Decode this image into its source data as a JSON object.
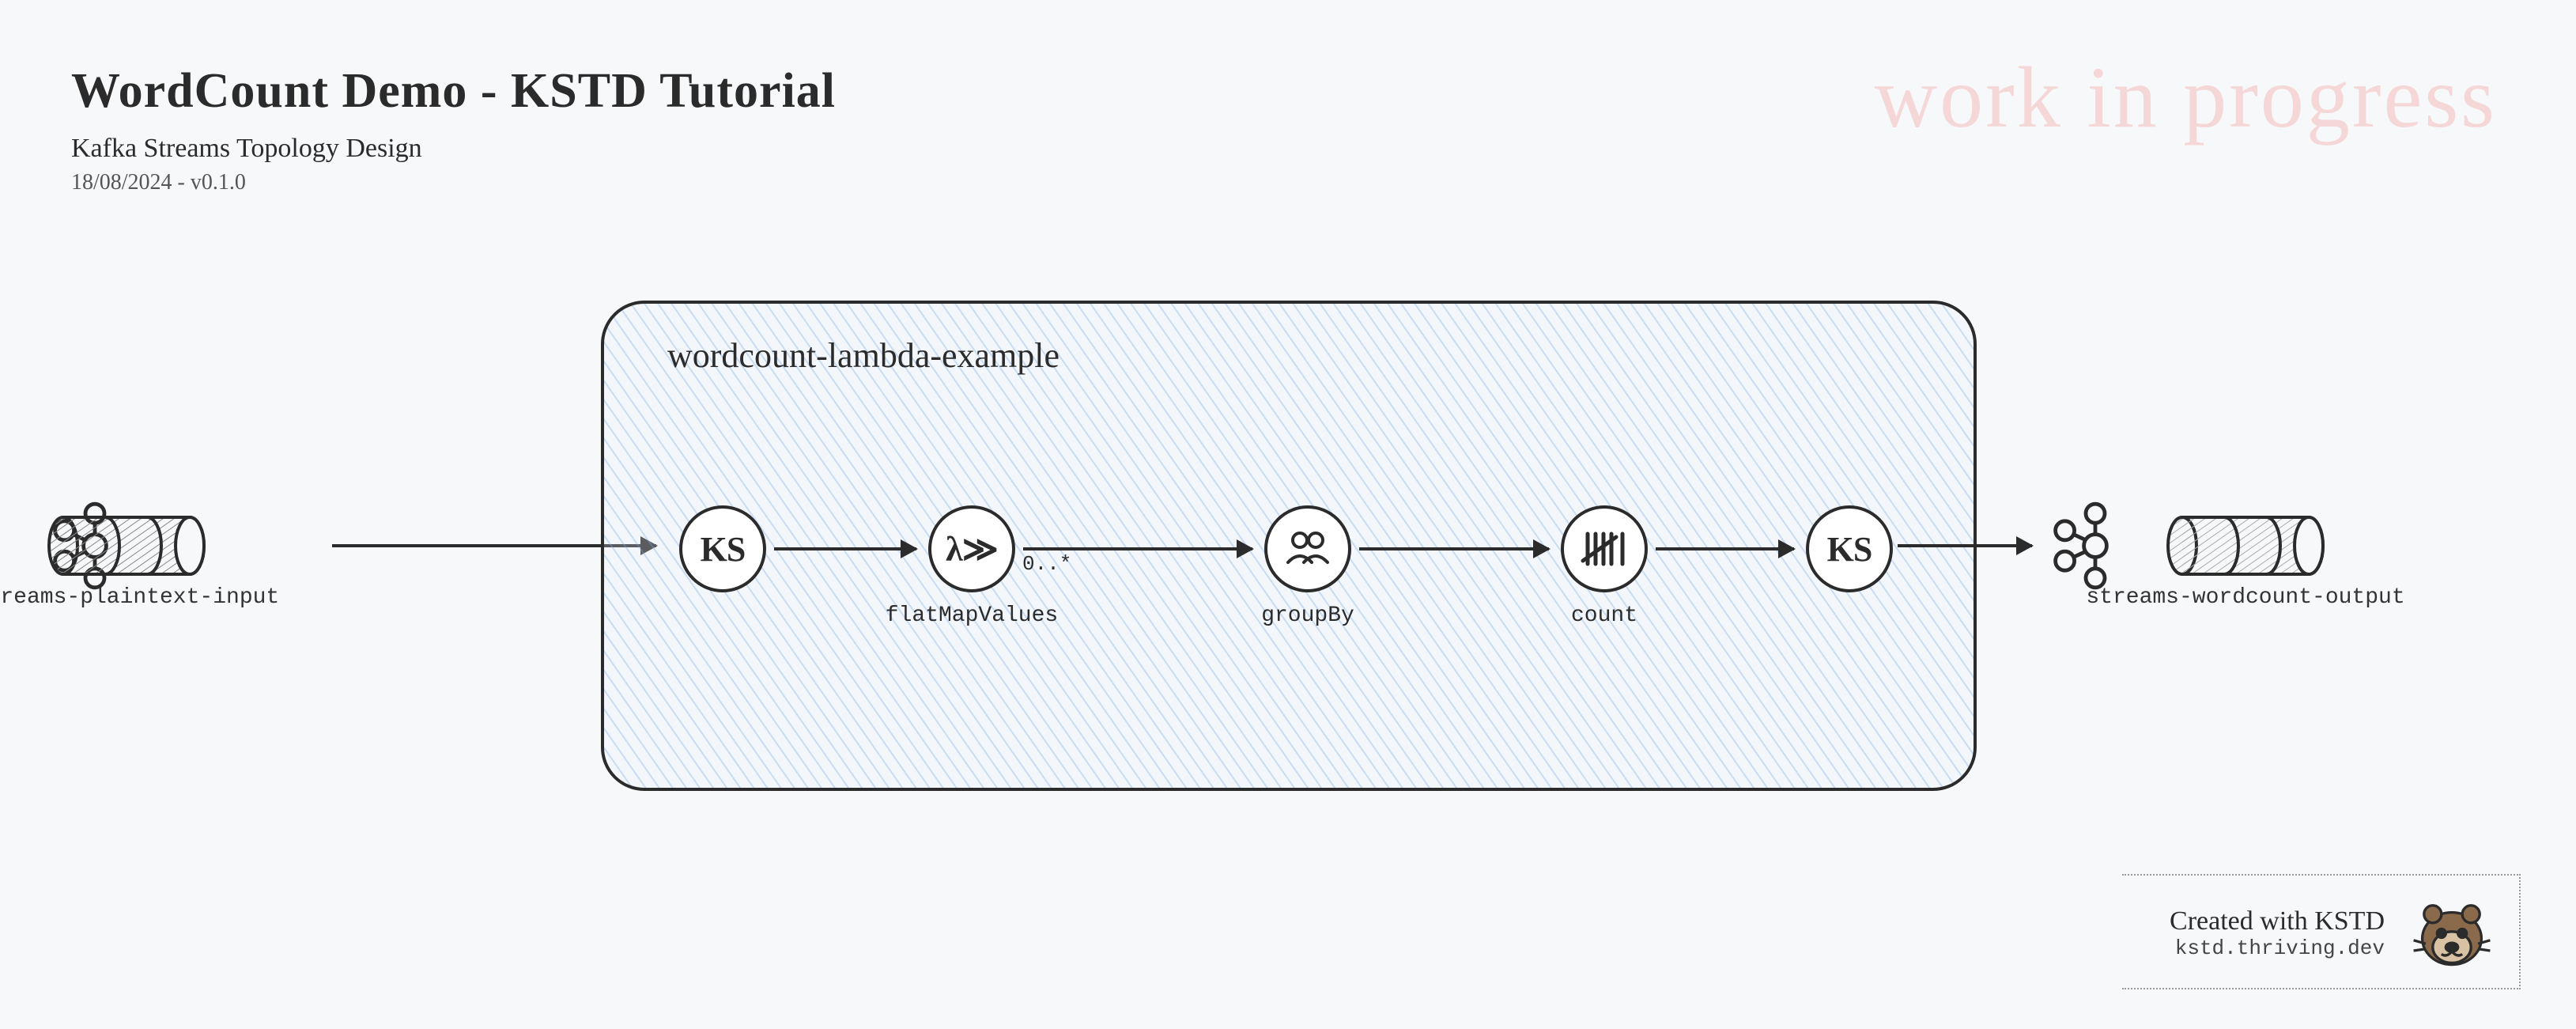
{
  "header": {
    "title": "WordCount Demo - KSTD Tutorial",
    "subtitle": "Kafka Streams Topology Design",
    "meta": "18/08/2024 - v0.1.0"
  },
  "watermark": "work in progress",
  "diagram": {
    "input_topic": "streams-plaintext-input",
    "output_topic": "streams-wordcount-output",
    "topology_name": "wordcount-lambda-example",
    "nodes": {
      "source": {
        "symbol": "KS",
        "label": ""
      },
      "flatmap": {
        "symbol": "λ≫",
        "label": "flatMapValues",
        "cardinality": "0..*"
      },
      "groupby": {
        "symbol": "groupBy-icon",
        "label": "groupBy"
      },
      "count": {
        "symbol": "tally-icon",
        "label": "count"
      },
      "sink": {
        "symbol": "KS",
        "label": ""
      }
    }
  },
  "footer": {
    "line1": "Created with KSTD",
    "line2": "kstd.thriving.dev"
  }
}
